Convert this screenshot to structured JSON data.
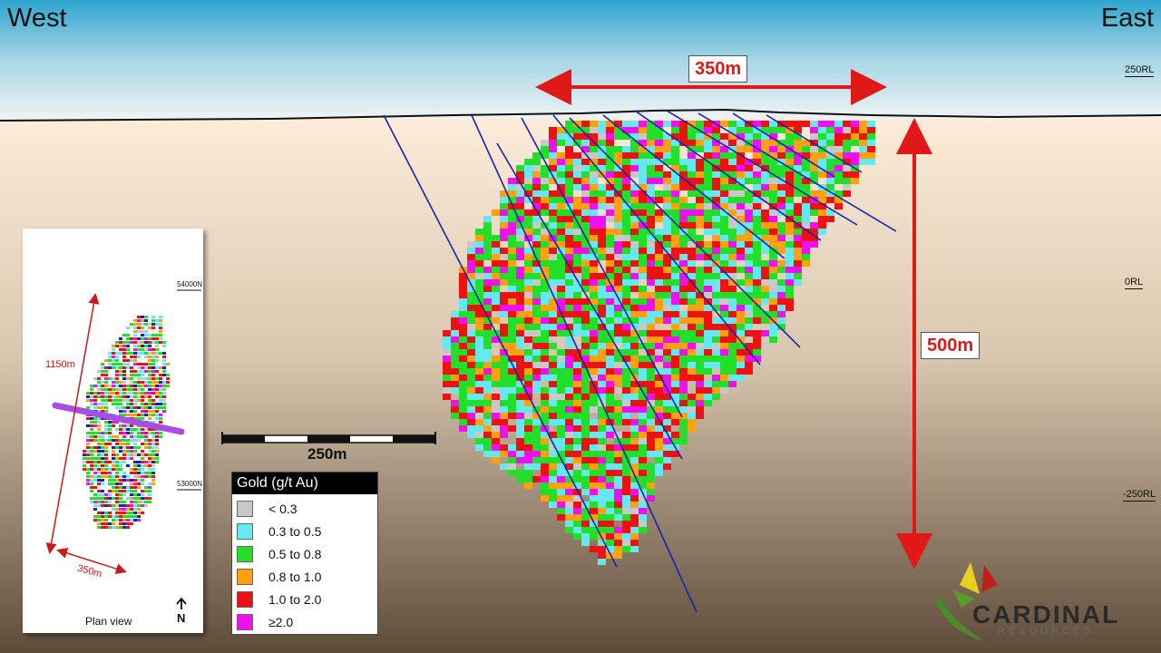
{
  "labels": {
    "west": "West",
    "east": "East",
    "width_dim": "350m",
    "depth_dim": "500m",
    "scale": "250m"
  },
  "levels": {
    "rl_250": "250RL",
    "rl_0": "0RL",
    "rl_neg250": "-250RL"
  },
  "plan": {
    "north_upper": "54000N",
    "north_lower": "53000N",
    "length": "1150m",
    "width": "350m",
    "caption": "Plan view",
    "north_arrow": "N"
  },
  "legend": {
    "title": "Gold (g/t Au)",
    "items": [
      {
        "label": "< 0.3",
        "color": "#c8c8c8"
      },
      {
        "label": "0.3 to 0.5",
        "color": "#66e8f0"
      },
      {
        "label": "0.5 to 0.8",
        "color": "#22e02a"
      },
      {
        "label": "0.8 to 1.0",
        "color": "#ffa010"
      },
      {
        "label": "1.0 to 2.0",
        "color": "#ee1111"
      },
      {
        "label": "≥2.0",
        "color": "#ee11ee"
      }
    ]
  },
  "logo": {
    "name": "CARDINAL",
    "sub": "RESOURCES"
  },
  "colors": {
    "drillhole": "#1424b4",
    "dimension": "#e01818",
    "plan_section": "#a84ee6"
  }
}
